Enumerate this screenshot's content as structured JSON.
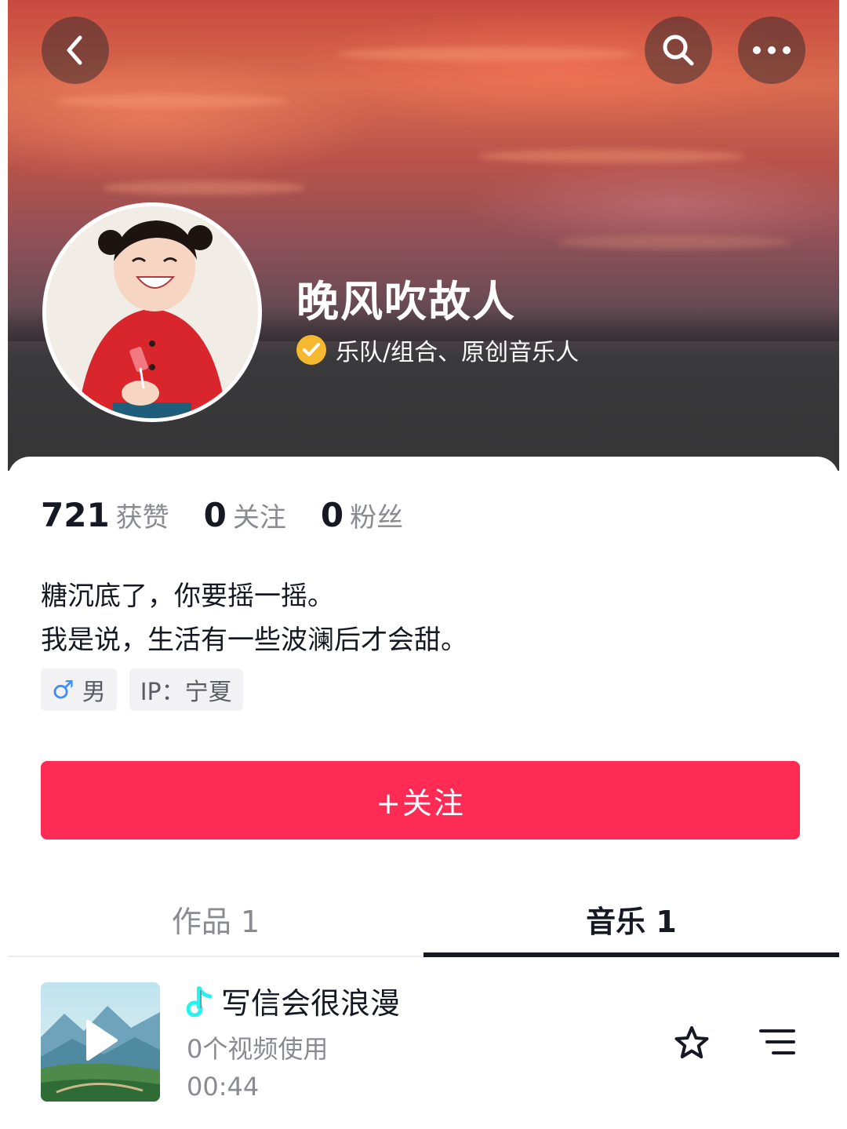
{
  "header": {
    "back_icon": "chevron-left-icon",
    "search_icon": "search-icon",
    "more_icon": "more-dots-icon"
  },
  "profile": {
    "nickname": "晚风吹故人",
    "verified_icon": "verified-check-icon",
    "verification": "乐队/组合、原创音乐人",
    "verified_color": "#f5b82e"
  },
  "stats": [
    {
      "value": "721",
      "label": "获赞"
    },
    {
      "value": "0",
      "label": "关注"
    },
    {
      "value": "0",
      "label": "粉丝"
    }
  ],
  "bio": {
    "line1": "糖沉底了，你要摇一摇。",
    "line2": "我是说，生活有一些波澜后才会甜。"
  },
  "tags": {
    "gender_symbol": "♂",
    "gender": "男",
    "ip": "IP：宁夏"
  },
  "follow_button": {
    "label": "+关注",
    "color": "#fe2c55"
  },
  "tabs": [
    {
      "label": "作品 1"
    },
    {
      "label": "音乐 1"
    }
  ],
  "music": {
    "note_icon": "music-note-icon",
    "title": "写信会很浪漫",
    "uses": "0个视频使用",
    "duration": "00:44",
    "play_icon": "play-icon",
    "favorite_icon": "star-icon",
    "more_icon": "list-menu-icon"
  }
}
